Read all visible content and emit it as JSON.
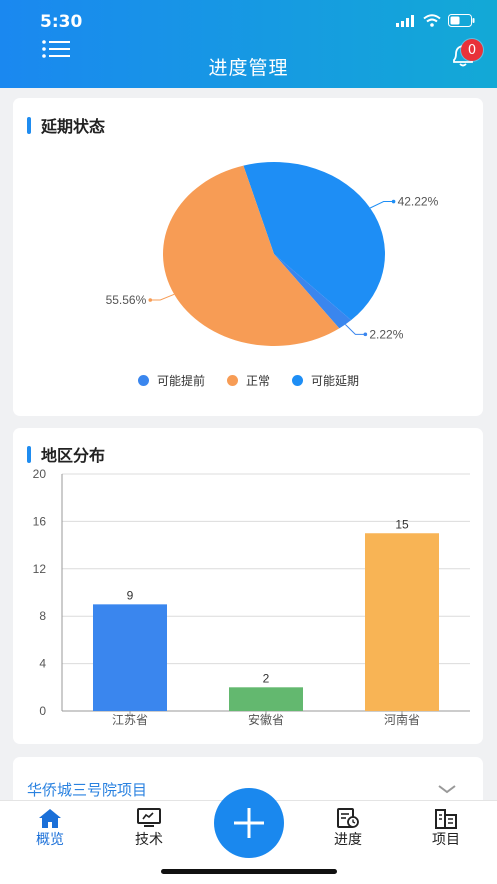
{
  "status_bar": {
    "time": "5:30"
  },
  "header": {
    "title": "进度管理",
    "notification_count": "0"
  },
  "delay_card": {
    "title": "延期状态",
    "legend": [
      {
        "label": "可能提前",
        "color": "#3a86ee"
      },
      {
        "label": "正常",
        "color": "#f79c55"
      },
      {
        "label": "可能延期",
        "color": "#1e8ef5"
      }
    ]
  },
  "region_card": {
    "title": "地区分布"
  },
  "chart_data": [
    {
      "type": "pie",
      "title": "延期状态",
      "slices": [
        {
          "label": "可能延期",
          "value": 42.22,
          "display": "42.22%",
          "color": "#1e8ef5"
        },
        {
          "label": "可能提前",
          "value": 2.22,
          "display": "2.22%",
          "color": "#3a86ee"
        },
        {
          "label": "正常",
          "value": 55.56,
          "display": "55.56%",
          "color": "#f79c55"
        }
      ]
    },
    {
      "type": "bar",
      "title": "地区分布",
      "categories": [
        "江苏省",
        "安徽省",
        "河南省"
      ],
      "values": [
        9,
        2,
        15
      ],
      "colors": [
        "#3a86ee",
        "#63b86f",
        "#f8b455"
      ],
      "ylim": [
        0,
        20
      ],
      "yticks": [
        0,
        4,
        8,
        12,
        16,
        20
      ],
      "grid": true
    }
  ],
  "project": {
    "name": "华侨城三号院项目"
  },
  "tabs": [
    {
      "label": "概览",
      "icon": "home-icon",
      "active": true
    },
    {
      "label": "技术",
      "icon": "monitor-icon",
      "active": false
    },
    {
      "label": "进度",
      "icon": "schedule-icon",
      "active": false
    },
    {
      "label": "项目",
      "icon": "building-icon",
      "active": false
    }
  ]
}
